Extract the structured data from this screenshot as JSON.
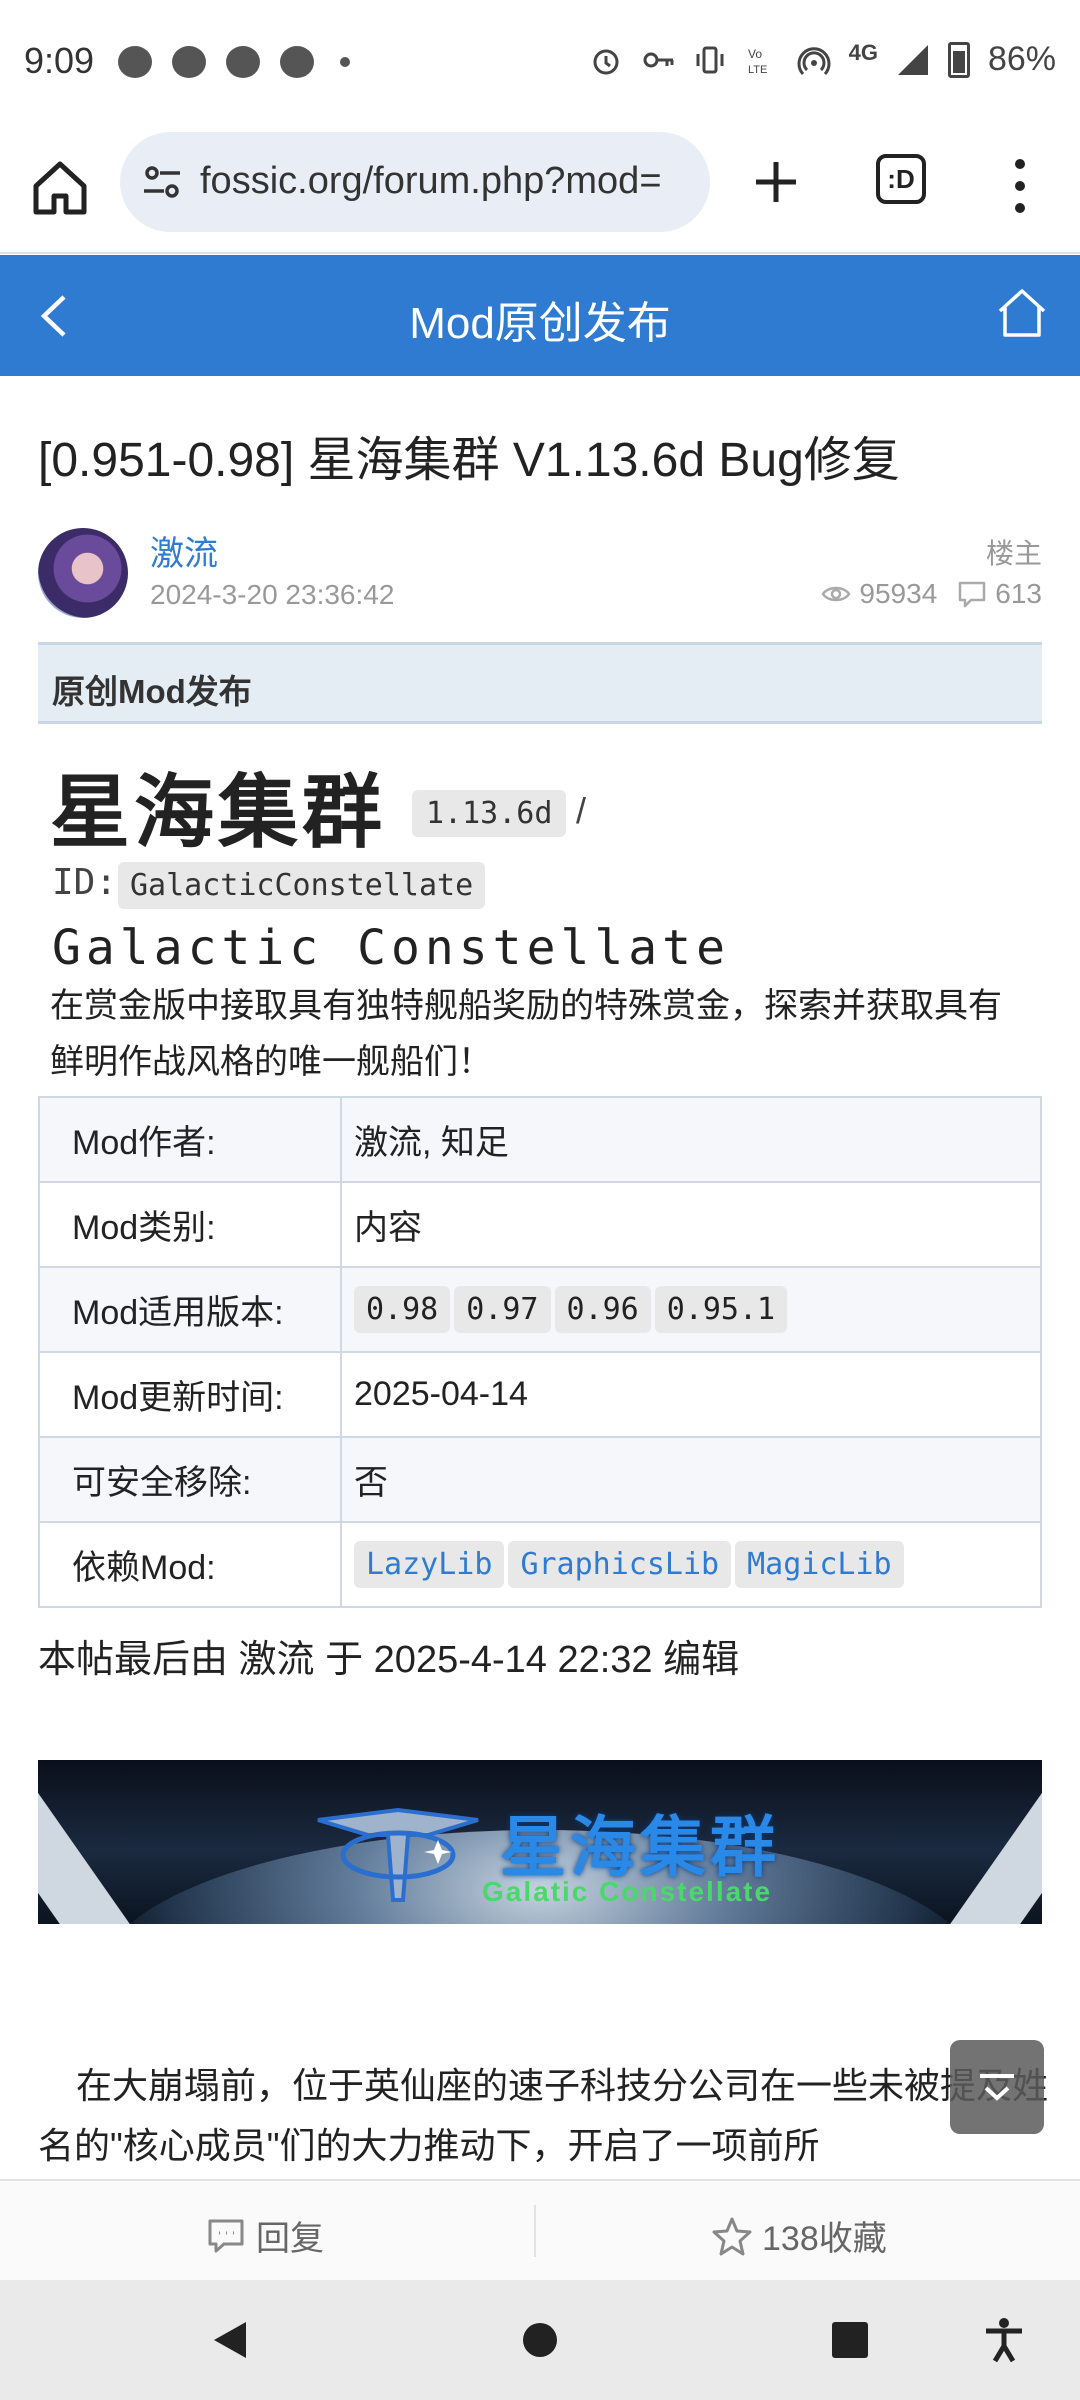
{
  "status_bar": {
    "time": "9:09",
    "battery": "86%",
    "network": "4G"
  },
  "browser": {
    "url": "fossic.org/forum.php?mod=",
    "tab_count": ":D"
  },
  "forum_header": {
    "title": "Mod原创发布"
  },
  "thread": {
    "title": "[0.951-0.98] 星海集群 V1.13.6d Bug修复",
    "author": "激流",
    "date": "2024-3-20 23:36:42",
    "op_label": "楼主",
    "views": "95934",
    "replies": "613"
  },
  "section": {
    "label": "原创Mod发布"
  },
  "mod": {
    "name": "星海集群",
    "version": "1.13.6d",
    "slash": "/",
    "id_label": "ID:",
    "id_value": "GalacticConstellate",
    "english_name": "Galactic Constellate",
    "description": "在赏金版中接取具有独特舰船奖励的特殊赏金，探索并获取具有鲜明作战风格的唯一舰船们！"
  },
  "info_table": {
    "author_key": "Mod作者:",
    "author_value": "激流, 知足",
    "type_key": "Mod类别:",
    "type_value": "内容",
    "versions_key": "Mod适用版本:",
    "versions": [
      "0.98",
      "0.97",
      "0.96",
      "0.95.1"
    ],
    "updated_key": "Mod更新时间:",
    "updated_value": "2025-04-14",
    "removable_key": "可安全移除:",
    "removable_value": "否",
    "deps_key": "依赖Mod:",
    "deps": [
      "LazyLib",
      "GraphicsLib",
      "MagicLib"
    ]
  },
  "edit_note": "本帖最后由 激流 于 2025-4-14 22:32 编辑",
  "banner": {
    "title_cn": "星海集群",
    "title_en": "Galatic Constellate"
  },
  "story_text": "在大崩塌前，位于英仙座的速子科技分公司在一些未被提及姓名的\"核心成员\"们的大力推动下，开启了一项前所",
  "action_bar": {
    "reply_label": "回复",
    "favorite_label": "138收藏"
  }
}
